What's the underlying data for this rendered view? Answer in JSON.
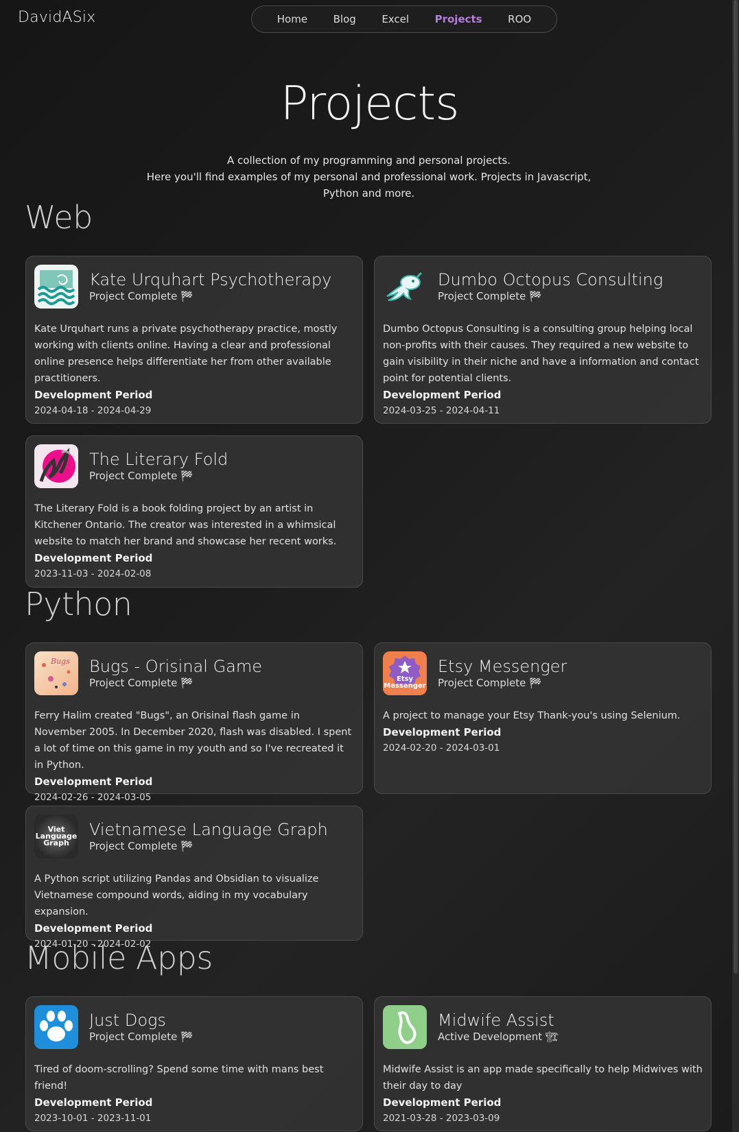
{
  "brand": "DavidASix",
  "nav": {
    "items": [
      "Home",
      "Blog",
      "Excel",
      "Projects",
      "ROO"
    ],
    "active": "Projects"
  },
  "header": {
    "title": "Projects",
    "intro_line1": "A collection of my programming and personal projects.",
    "intro_line2": "Here you'll find examples of my personal and professional work. Projects in Javascript, Python and more."
  },
  "labels": {
    "dev_period": "Development Period"
  },
  "sections": [
    {
      "title": "Web",
      "projects": [
        {
          "title": "Kate Urquhart Psychotherapy",
          "status": "Project Complete 🏁",
          "description": "Kate Urquhart runs a private psychotherapy practice, mostly working with clients online. Having a clear and professional online presence helps differentiate her from other available practitioners.",
          "dates": "2024-04-18 - 2024-04-29",
          "icon": "waves-logo-icon"
        },
        {
          "title": "Dumbo Octopus Consulting",
          "status": "Project Complete 🏁",
          "description": "Dumbo Octopus Consulting is a consulting group helping local non-profits with their causes. They required a new website to gain visibility in their niche and have a information and contact point for potential clients.",
          "dates": "2024-03-25 - 2024-04-11",
          "icon": "octopus-logo-icon"
        },
        {
          "title": "The Literary Fold",
          "status": "Project Complete 🏁",
          "description": "The Literary Fold is a book folding project by an artist in Kitchener Ontario. The creator was interested in a whimsical website to match her brand and showcase her recent works.",
          "dates": "2023-11-03 - 2024-02-08",
          "icon": "book-fold-logo-icon"
        }
      ]
    },
    {
      "title": "Python",
      "projects": [
        {
          "title": "Bugs - Orisinal Game",
          "status": "Project Complete 🏁",
          "description": "Ferry Halim created \"Bugs\", an Orisinal flash game in November 2005. In December 2020, flash was disabled. I spent a lot of time on this game in my youth and so I've recreated it in Python.",
          "dates": "2024-02-26 - 2024-03-05",
          "icon": "bugs-game-logo-icon",
          "logo_text": "Bugs"
        },
        {
          "title": "Etsy Messenger",
          "status": "Project Complete 🏁",
          "description": "A project to manage your Etsy Thank-you's using Selenium.",
          "dates": "2024-02-20 - 2024-03-01",
          "icon": "etsy-messenger-logo-icon",
          "logo_text_1": "Etsy",
          "logo_text_2": "Messenger"
        },
        {
          "title": "Vietnamese Language Graph",
          "status": "Project Complete 🏁",
          "description": "A Python script utilizing Pandas and Obsidian to visualize Vietnamese compound words, aiding in my vocabulary expansion.",
          "dates": "2024-01-20 - 2024-02-02",
          "icon": "language-graph-logo-icon",
          "logo_text_1": "Viet",
          "logo_text_2": "Language",
          "logo_text_3": "Graph"
        }
      ]
    },
    {
      "title": "Mobile Apps",
      "projects": [
        {
          "title": "Just Dogs",
          "status": "Project Complete 🏁",
          "description": "Tired of doom-scrolling? Spend some time with mans best friend!",
          "dates": "2023-10-01 - 2023-11-01",
          "icon": "paw-logo-icon"
        },
        {
          "title": "Midwife Assist",
          "status": "Active Development 🏗",
          "description": "Midwife Assist is an app made specifically to help Midwives with their day to day",
          "dates": "2021-03-28 - 2023-03-09",
          "icon": "midwife-logo-icon"
        }
      ]
    }
  ]
}
